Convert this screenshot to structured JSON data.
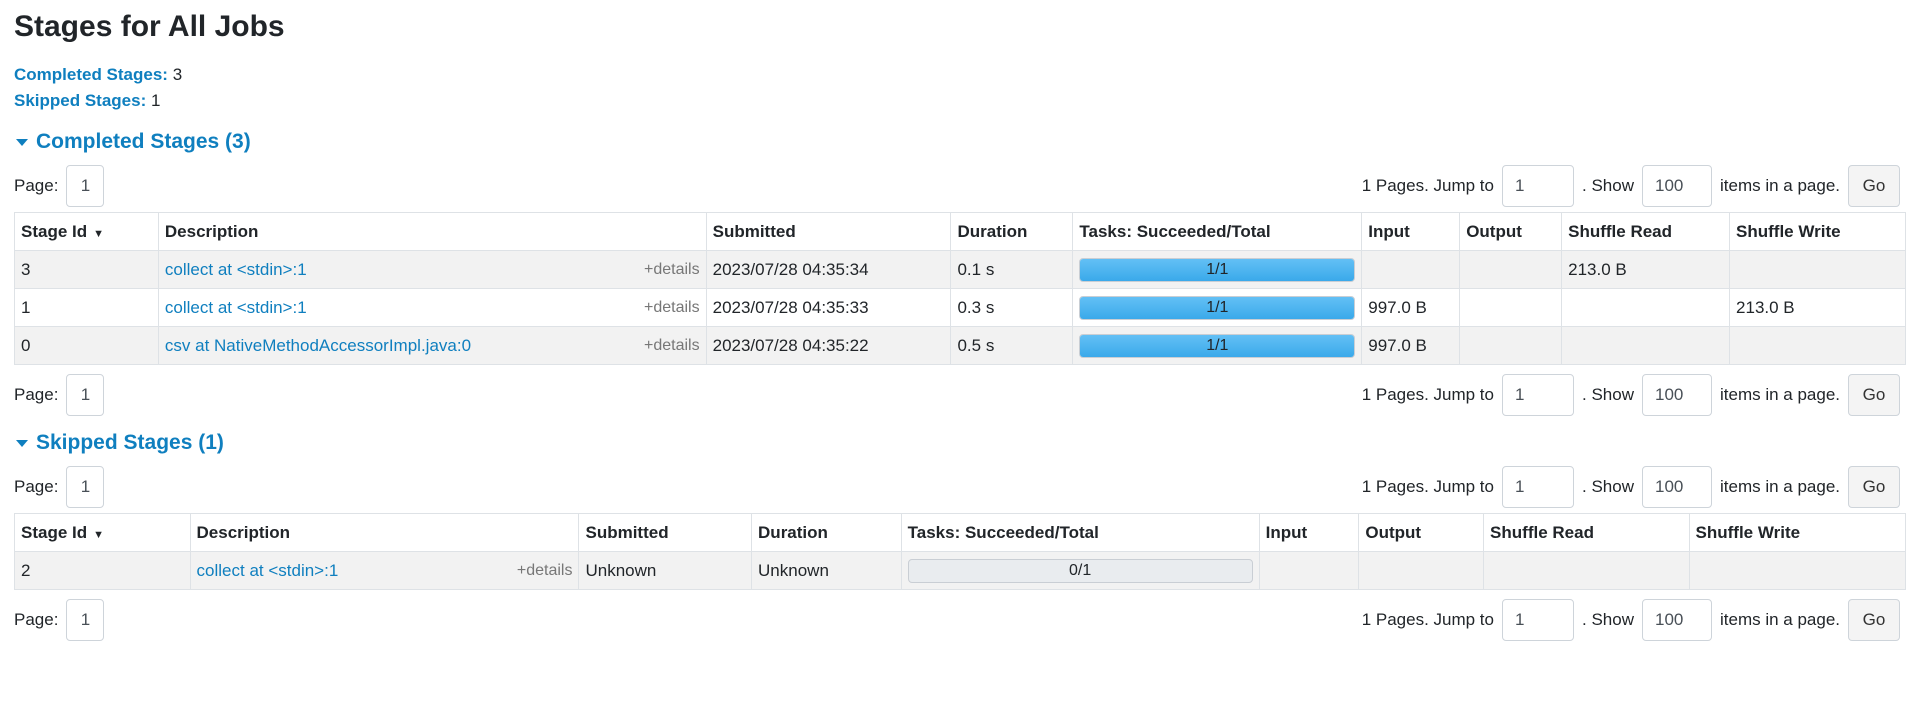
{
  "title": "Stages for All Jobs",
  "summary": {
    "completed_label": "Completed Stages:",
    "completed_value": "3",
    "skipped_label": "Skipped Stages:",
    "skipped_value": "1"
  },
  "pager": {
    "page_label": "Page:",
    "page_value": "1",
    "pages_text": "1 Pages. Jump to",
    "jump_value": "1",
    "show_text": ". Show",
    "show_value": "100",
    "items_text": "items in a page.",
    "go_label": "Go"
  },
  "completed": {
    "heading": "Completed Stages (3)",
    "columns": [
      "Stage Id",
      "Description",
      "Submitted",
      "Duration",
      "Tasks: Succeeded/Total",
      "Input",
      "Output",
      "Shuffle Read",
      "Shuffle Write"
    ],
    "rows": [
      {
        "id": "3",
        "desc": "collect at <stdin>:1",
        "details": "+details",
        "submitted": "2023/07/28 04:35:34",
        "duration": "0.1 s",
        "tasks": "1/1",
        "progress": 1.0,
        "input": "",
        "output": "",
        "shuffle_read": "213.0 B",
        "shuffle_write": ""
      },
      {
        "id": "1",
        "desc": "collect at <stdin>:1",
        "details": "+details",
        "submitted": "2023/07/28 04:35:33",
        "duration": "0.3 s",
        "tasks": "1/1",
        "progress": 1.0,
        "input": "997.0 B",
        "output": "",
        "shuffle_read": "",
        "shuffle_write": "213.0 B"
      },
      {
        "id": "0",
        "desc": "csv at NativeMethodAccessorImpl.java:0",
        "details": "+details",
        "submitted": "2023/07/28 04:35:22",
        "duration": "0.5 s",
        "tasks": "1/1",
        "progress": 1.0,
        "input": "997.0 B",
        "output": "",
        "shuffle_read": "",
        "shuffle_write": ""
      }
    ]
  },
  "skipped": {
    "heading": "Skipped Stages (1)",
    "columns": [
      "Stage Id",
      "Description",
      "Submitted",
      "Duration",
      "Tasks: Succeeded/Total",
      "Input",
      "Output",
      "Shuffle Read",
      "Shuffle Write"
    ],
    "rows": [
      {
        "id": "2",
        "desc": "collect at <stdin>:1",
        "details": "+details",
        "submitted": "Unknown",
        "duration": "Unknown",
        "tasks": "0/1",
        "progress": 0.0,
        "input": "",
        "output": "",
        "shuffle_read": "",
        "shuffle_write": ""
      }
    ]
  },
  "icons": {
    "sort": "sort-desc-icon",
    "collapse": "caret-down-icon"
  },
  "colors": {
    "accent": "#0f7fbf",
    "progress": "#3aa9ea"
  }
}
